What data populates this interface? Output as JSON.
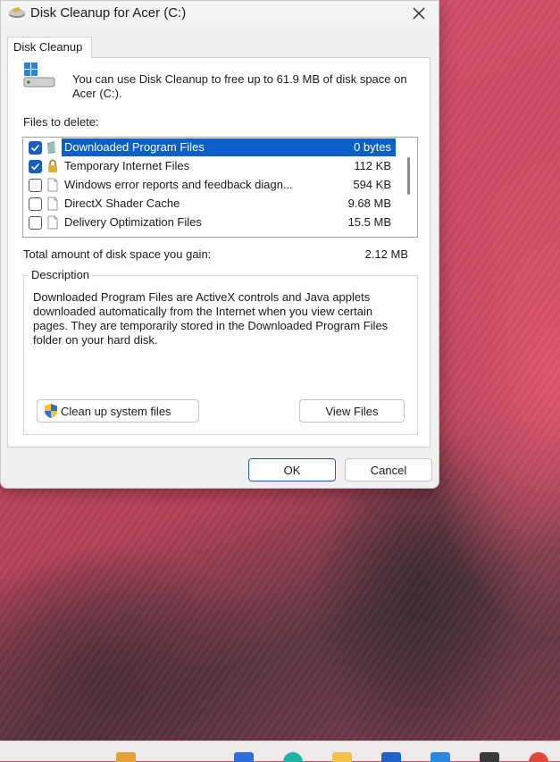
{
  "window": {
    "title": "Disk Cleanup for Acer (C:)"
  },
  "tab": {
    "label": "Disk Cleanup"
  },
  "intro": {
    "text": "You can use Disk Cleanup to free up to 61.9 MB of disk space on Acer (C:)."
  },
  "files": {
    "label": "Files to delete:",
    "items": [
      {
        "name": "Downloaded Program Files",
        "size": "0 bytes",
        "checked": true,
        "selected": true,
        "icon": "folder-icon"
      },
      {
        "name": "Temporary Internet Files",
        "size": "112 KB",
        "checked": true,
        "selected": false,
        "icon": "lock-icon"
      },
      {
        "name": "Windows error reports and feedback diagn...",
        "size": "594 KB",
        "checked": false,
        "selected": false,
        "icon": "file-icon"
      },
      {
        "name": "DirectX Shader Cache",
        "size": "9.68 MB",
        "checked": false,
        "selected": false,
        "icon": "file-icon"
      },
      {
        "name": "Delivery Optimization Files",
        "size": "15.5 MB",
        "checked": false,
        "selected": false,
        "icon": "file-icon"
      }
    ]
  },
  "total": {
    "label": "Total amount of disk space you gain:",
    "value": "2.12 MB"
  },
  "description": {
    "legend": "Description",
    "text": "Downloaded Program Files are ActiveX controls and Java applets downloaded automatically from the Internet when you view certain pages. They are temporarily stored in the Downloaded Program Files folder on your hard disk."
  },
  "buttons": {
    "cleanup_system": "Clean up system files",
    "view_files": "View Files",
    "ok": "OK",
    "cancel": "Cancel"
  },
  "colors": {
    "accent": "#0a5fc9",
    "checkbox": "#1a5dbf",
    "wallpaper": "#c94a64"
  }
}
